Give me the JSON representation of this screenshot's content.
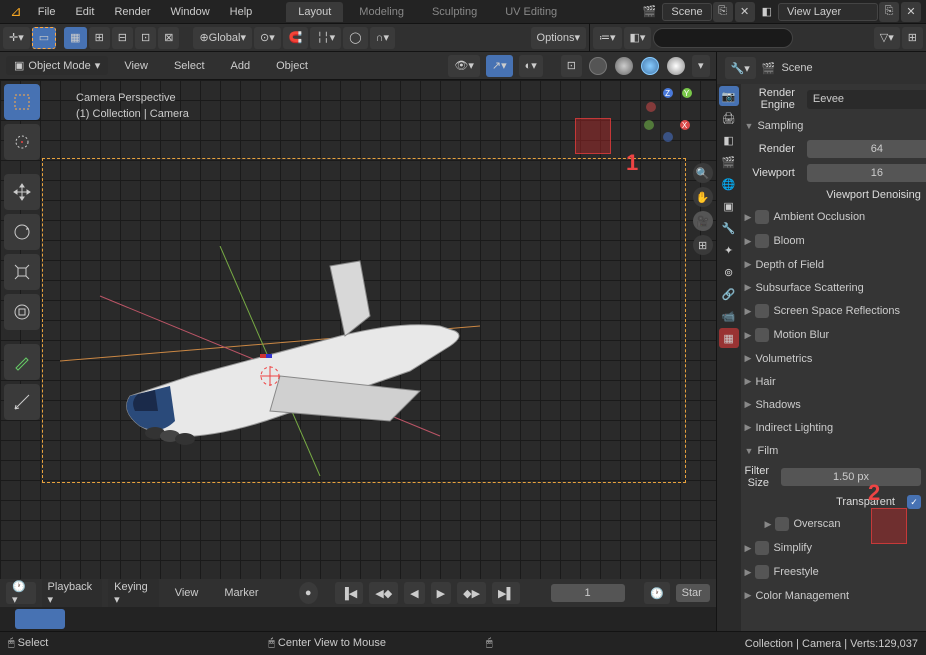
{
  "menus": {
    "file": "File",
    "edit": "Edit",
    "render": "Render",
    "window": "Window",
    "help": "Help"
  },
  "tabs": {
    "layout": "Layout",
    "modeling": "Modeling",
    "sculpting": "Sculpting",
    "uv": "UV Editing"
  },
  "scene_selector": {
    "label": "Scene",
    "layer": "View Layer"
  },
  "transform_orient": "Global",
  "toolbar_options": "Options",
  "mode": "Object Mode",
  "vp_menus": {
    "view": "View",
    "select": "Select",
    "add": "Add",
    "object": "Object"
  },
  "vp_info": {
    "title": "Camera Perspective",
    "sub": "(1) Collection | Camera"
  },
  "axes": {
    "x": "X",
    "y": "Y",
    "z": "Z"
  },
  "timeline": {
    "playback": "Playback",
    "keying": "Keying",
    "view": "View",
    "marker": "Marker",
    "frame": "1",
    "end": "Star"
  },
  "status": {
    "select": "Select",
    "center": "Center View to Mouse",
    "verts": "Collection | Camera | Verts:129,037"
  },
  "props": {
    "scene_label": "Scene",
    "render_engine_label": "Render Engine",
    "render_engine_val": "Eevee",
    "sampling": "Sampling",
    "render_label": "Render",
    "render_val": "64",
    "viewport_label": "Viewport",
    "viewport_val": "16",
    "denoising": "Viewport Denoising",
    "ao": "Ambient Occlusion",
    "bloom": "Bloom",
    "dof": "Depth of Field",
    "sss": "Subsurface Scattering",
    "ssr": "Screen Space Reflections",
    "motion": "Motion Blur",
    "vol": "Volumetrics",
    "hair": "Hair",
    "shadows": "Shadows",
    "indirect": "Indirect Lighting",
    "film": "Film",
    "filter_label": "Filter Size",
    "filter_val": "1.50 px",
    "transparent": "Transparent",
    "overscan": "Overscan",
    "simplify": "Simplify",
    "freestyle": "Freestyle",
    "colormgmt": "Color Management"
  },
  "highlights": {
    "one": "1",
    "two": "2"
  }
}
